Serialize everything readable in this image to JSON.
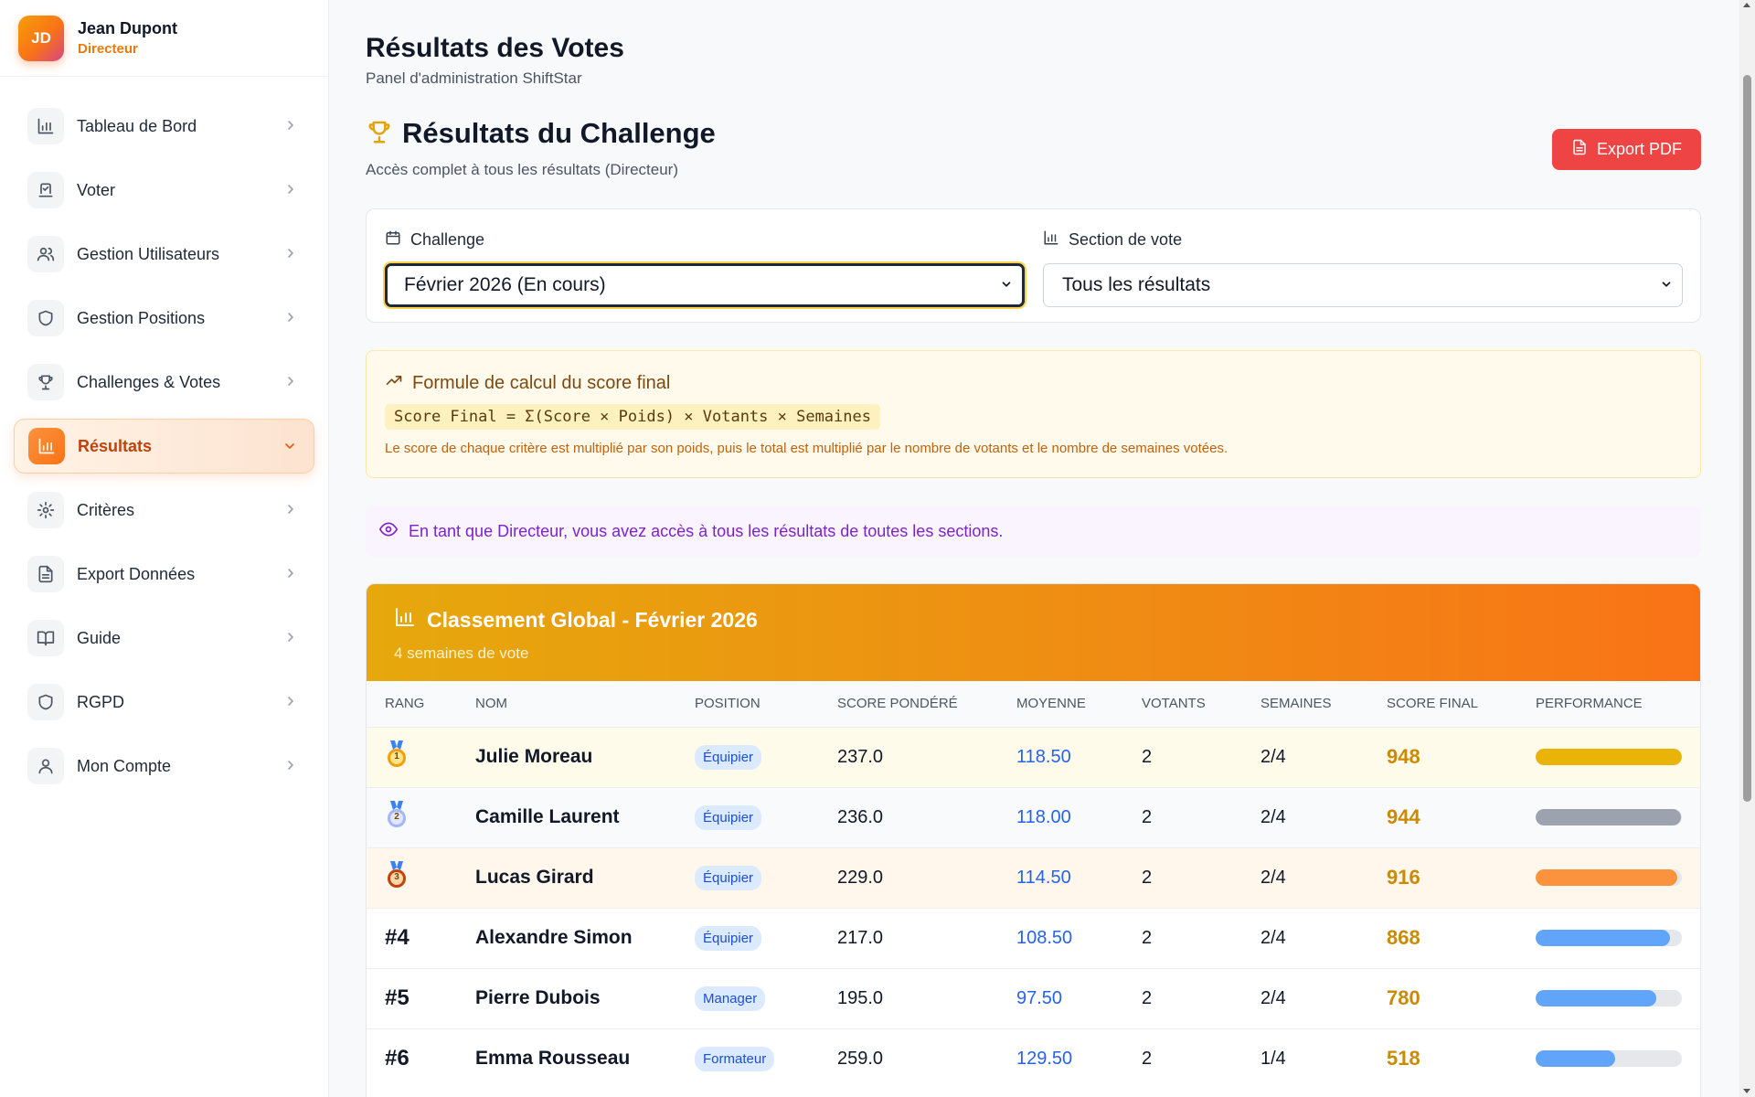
{
  "user": {
    "initials": "JD",
    "name": "Jean Dupont",
    "role": "Directeur"
  },
  "sidebar": {
    "items": [
      {
        "label": "Tableau de Bord",
        "icon": "bar-chart-icon"
      },
      {
        "label": "Voter",
        "icon": "vote-icon"
      },
      {
        "label": "Gestion Utilisateurs",
        "icon": "users-icon"
      },
      {
        "label": "Gestion Positions",
        "icon": "shield-icon"
      },
      {
        "label": "Challenges & Votes",
        "icon": "trophy-icon"
      },
      {
        "label": "Résultats",
        "icon": "bar-chart-icon",
        "active": true
      },
      {
        "label": "Critères",
        "icon": "gear-icon"
      },
      {
        "label": "Export Données",
        "icon": "file-icon"
      },
      {
        "label": "Guide",
        "icon": "book-icon"
      },
      {
        "label": "RGPD",
        "icon": "shield-icon"
      },
      {
        "label": "Mon Compte",
        "icon": "user-icon"
      }
    ]
  },
  "header": {
    "title": "Résultats des Votes",
    "subtitle": "Panel d'administration ShiftStar"
  },
  "section": {
    "title": "Résultats du Challenge",
    "subtitle": "Accès complet à tous les résultats (Directeur)",
    "export_label": "Export PDF"
  },
  "filters": {
    "challenge_label": "Challenge",
    "challenge_value": "Février 2026 (En cours)",
    "section_label": "Section de vote",
    "section_value": "Tous les résultats"
  },
  "formula": {
    "title": "Formule de calcul du score final",
    "code": "Score Final = Σ(Score × Poids) × Votants × Semaines",
    "note": "Le score de chaque critère est multiplié par son poids, puis le total est multiplié par le nombre de votants et le nombre de semaines votées."
  },
  "info_text": "En tant que Directeur, vous avez accès à tous les résultats de toutes les sections.",
  "ranking": {
    "title": "Classement Global - Février 2026",
    "subtitle": "4 semaines de vote",
    "columns": [
      "Rang",
      "Nom",
      "Position",
      "Score pondéré",
      "Moyenne",
      "Votants",
      "Semaines",
      "Score final",
      "Performance"
    ],
    "rows": [
      {
        "rank": "1",
        "medal": "gold",
        "name": "Julie Moreau",
        "position": "Équipier",
        "weighted": "237.0",
        "average": "118.50",
        "voters": "2",
        "weeks": "2/4",
        "final": "948",
        "performance": 1.0,
        "bar_color": "#eab308"
      },
      {
        "rank": "2",
        "medal": "silver",
        "name": "Camille Laurent",
        "position": "Équipier",
        "weighted": "236.0",
        "average": "118.00",
        "voters": "2",
        "weeks": "2/4",
        "final": "944",
        "performance": 0.996,
        "bar_color": "#9ca3af"
      },
      {
        "rank": "3",
        "medal": "bronze",
        "name": "Lucas Girard",
        "position": "Équipier",
        "weighted": "229.0",
        "average": "114.50",
        "voters": "2",
        "weeks": "2/4",
        "final": "916",
        "performance": 0.966,
        "bar_color": "#fb923c"
      },
      {
        "rank": "#4",
        "medal": "",
        "name": "Alexandre Simon",
        "position": "Équipier",
        "weighted": "217.0",
        "average": "108.50",
        "voters": "2",
        "weeks": "2/4",
        "final": "868",
        "performance": 0.916,
        "bar_color": "#60a5fa"
      },
      {
        "rank": "#5",
        "medal": "",
        "name": "Pierre Dubois",
        "position": "Manager",
        "weighted": "195.0",
        "average": "97.50",
        "voters": "2",
        "weeks": "2/4",
        "final": "780",
        "performance": 0.823,
        "bar_color": "#60a5fa"
      },
      {
        "rank": "#6",
        "medal": "",
        "name": "Emma Rousseau",
        "position": "Formateur",
        "weighted": "259.0",
        "average": "129.50",
        "voters": "2",
        "weeks": "1/4",
        "final": "518",
        "performance": 0.546,
        "bar_color": "#60a5fa"
      }
    ]
  }
}
